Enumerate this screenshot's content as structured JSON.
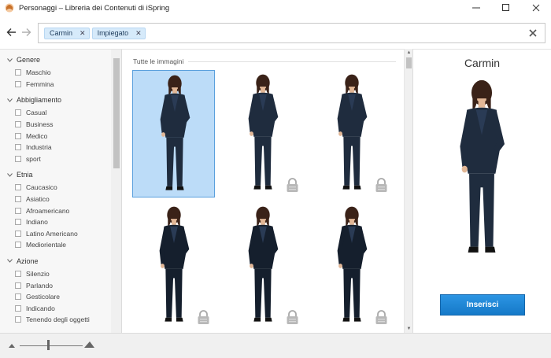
{
  "window": {
    "title": "Personaggi – Libreria dei Contenuti di iSpring"
  },
  "search": {
    "tags": [
      {
        "label": "Carmin"
      },
      {
        "label": "Impiegato"
      }
    ]
  },
  "filters": {
    "groups": [
      {
        "label": "Genere",
        "items": [
          "Maschio",
          "Femmina"
        ]
      },
      {
        "label": "Abbigliamento",
        "items": [
          "Casual",
          "Business",
          "Medico",
          "Industria",
          "sport"
        ]
      },
      {
        "label": "Etnia",
        "items": [
          "Caucasico",
          "Asiatico",
          "Afroamericano",
          "Indiano",
          "Latino Americano",
          "Mediorientale"
        ]
      },
      {
        "label": "Azione",
        "items": [
          "Silenzio",
          "Parlando",
          "Gesticolare",
          "Indicando",
          "Tenendo degli oggetti"
        ]
      }
    ]
  },
  "gallery": {
    "section_title": "Tutte le immagini"
  },
  "preview": {
    "name": "Carmin",
    "insert_label": "Inserisci"
  },
  "colors": {
    "accent": "#1c84d4",
    "selection": "#bcdcf8",
    "suit": "#1f2c3e"
  }
}
